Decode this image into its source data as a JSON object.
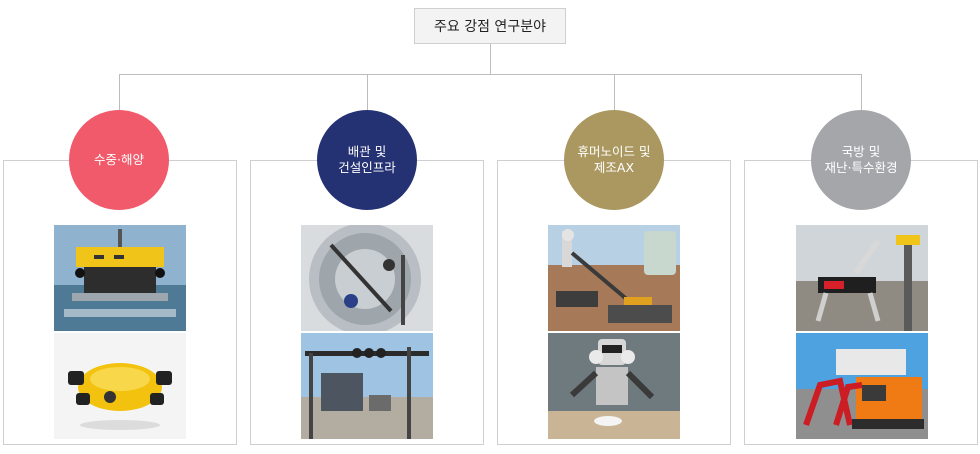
{
  "root": {
    "label": "주요 강점 연구분야"
  },
  "categories": [
    {
      "label": "수중·해양",
      "color": "#f05a6b"
    },
    {
      "label": "배관 및\n건설인프라",
      "color": "#243172"
    },
    {
      "label": "휴머노이드 및\n제조AX",
      "color": "#ab9860"
    },
    {
      "label": "국방 및\n재난·특수환경",
      "color": "#a5a6a9"
    }
  ],
  "colors": {
    "line": "#bdbdbd",
    "border": "#cfcfcf"
  }
}
